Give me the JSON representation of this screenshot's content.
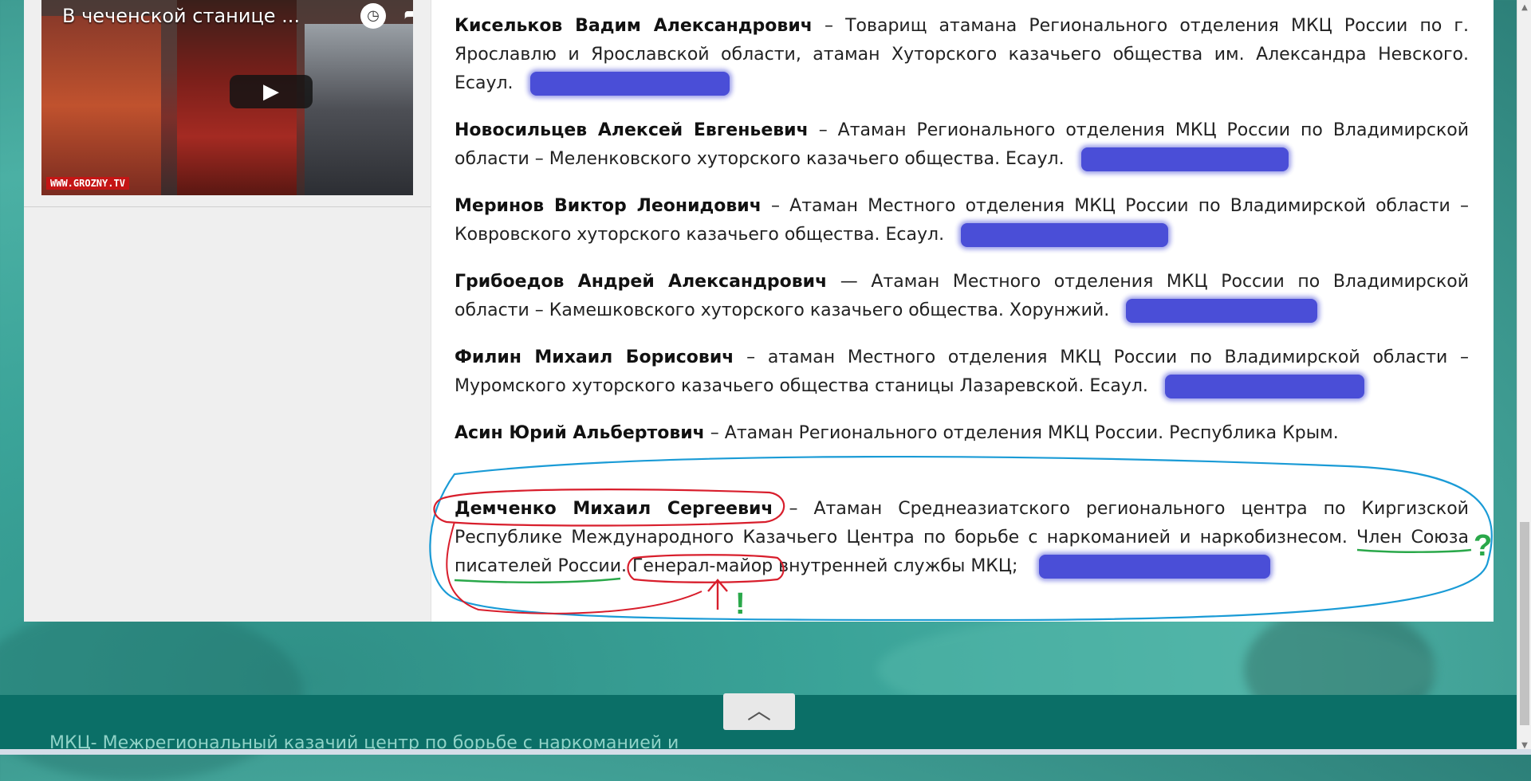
{
  "video": {
    "title": "В чеченской станице ...",
    "clock_icon": "clock-icon",
    "share_icon": "share-icon",
    "play_icon": "play-icon",
    "brand": "WWW.GROZNY.TV"
  },
  "entries": [
    {
      "name": "Кисельков Вадим Александрович",
      "text": " – Товарищ атамана  Регионального отделения МКЦ России по г. Ярославлю и Ярославской области, атаман Хуторского казачьего общества им. Александра Невского. Есаул."
    },
    {
      "name": "Новосильцев Алексей Евгеньевич",
      "text": " – Атаман Регионального отделения МКЦ России по Владимирской области – Меленковского хуторского казачьего общества. Есаул."
    },
    {
      "name": "Меринов Виктор Леонидович",
      "text": "  – Атаман Местного отделения МКЦ России по Владимирской области – Ковровского хуторского казачьего общества. Есаул."
    },
    {
      "name": "Грибоедов Андрей Александрович",
      "text": " — Атаман Местного отделения МКЦ России по Владимирской области – Камешковского хуторского казачьего общества. Хорунжий."
    },
    {
      "name": "Филин Михаил Борисович",
      "text": " – атаман Местного отделения МКЦ России по Владимирской области – Муромского хуторского казачьего общества станицы Лазаревской. Есаул."
    },
    {
      "name": "Асин Юрий Альбертович",
      "text": " – Атаман Регионального отделения МКЦ России. Республика Крым."
    }
  ],
  "highlight_entry": {
    "name": "Демченко Михаил Сергеевич",
    "text1": " – Атаман Среднеазиатского регионального центра по Киргизской Республике Международного Казачьего Центра по борьбе с наркоманией и наркобизнесом.  Член Союза писателей России. ",
    "rank": "Генерал-майор",
    "text2": " внутренней службы МКЦ;"
  },
  "annotations": {
    "question_mark": "?",
    "exclamation_mark": "!",
    "colors": {
      "red": "#d81e2c",
      "blue": "#1a9bd6",
      "green": "#2aa84a",
      "redact": "#3b3fd4"
    }
  },
  "footer": {
    "text": "МКЦ- Межрегиональный казачий центр по борьбе с наркоманией и",
    "back_to_top_icon": "chevron-up-icon"
  }
}
